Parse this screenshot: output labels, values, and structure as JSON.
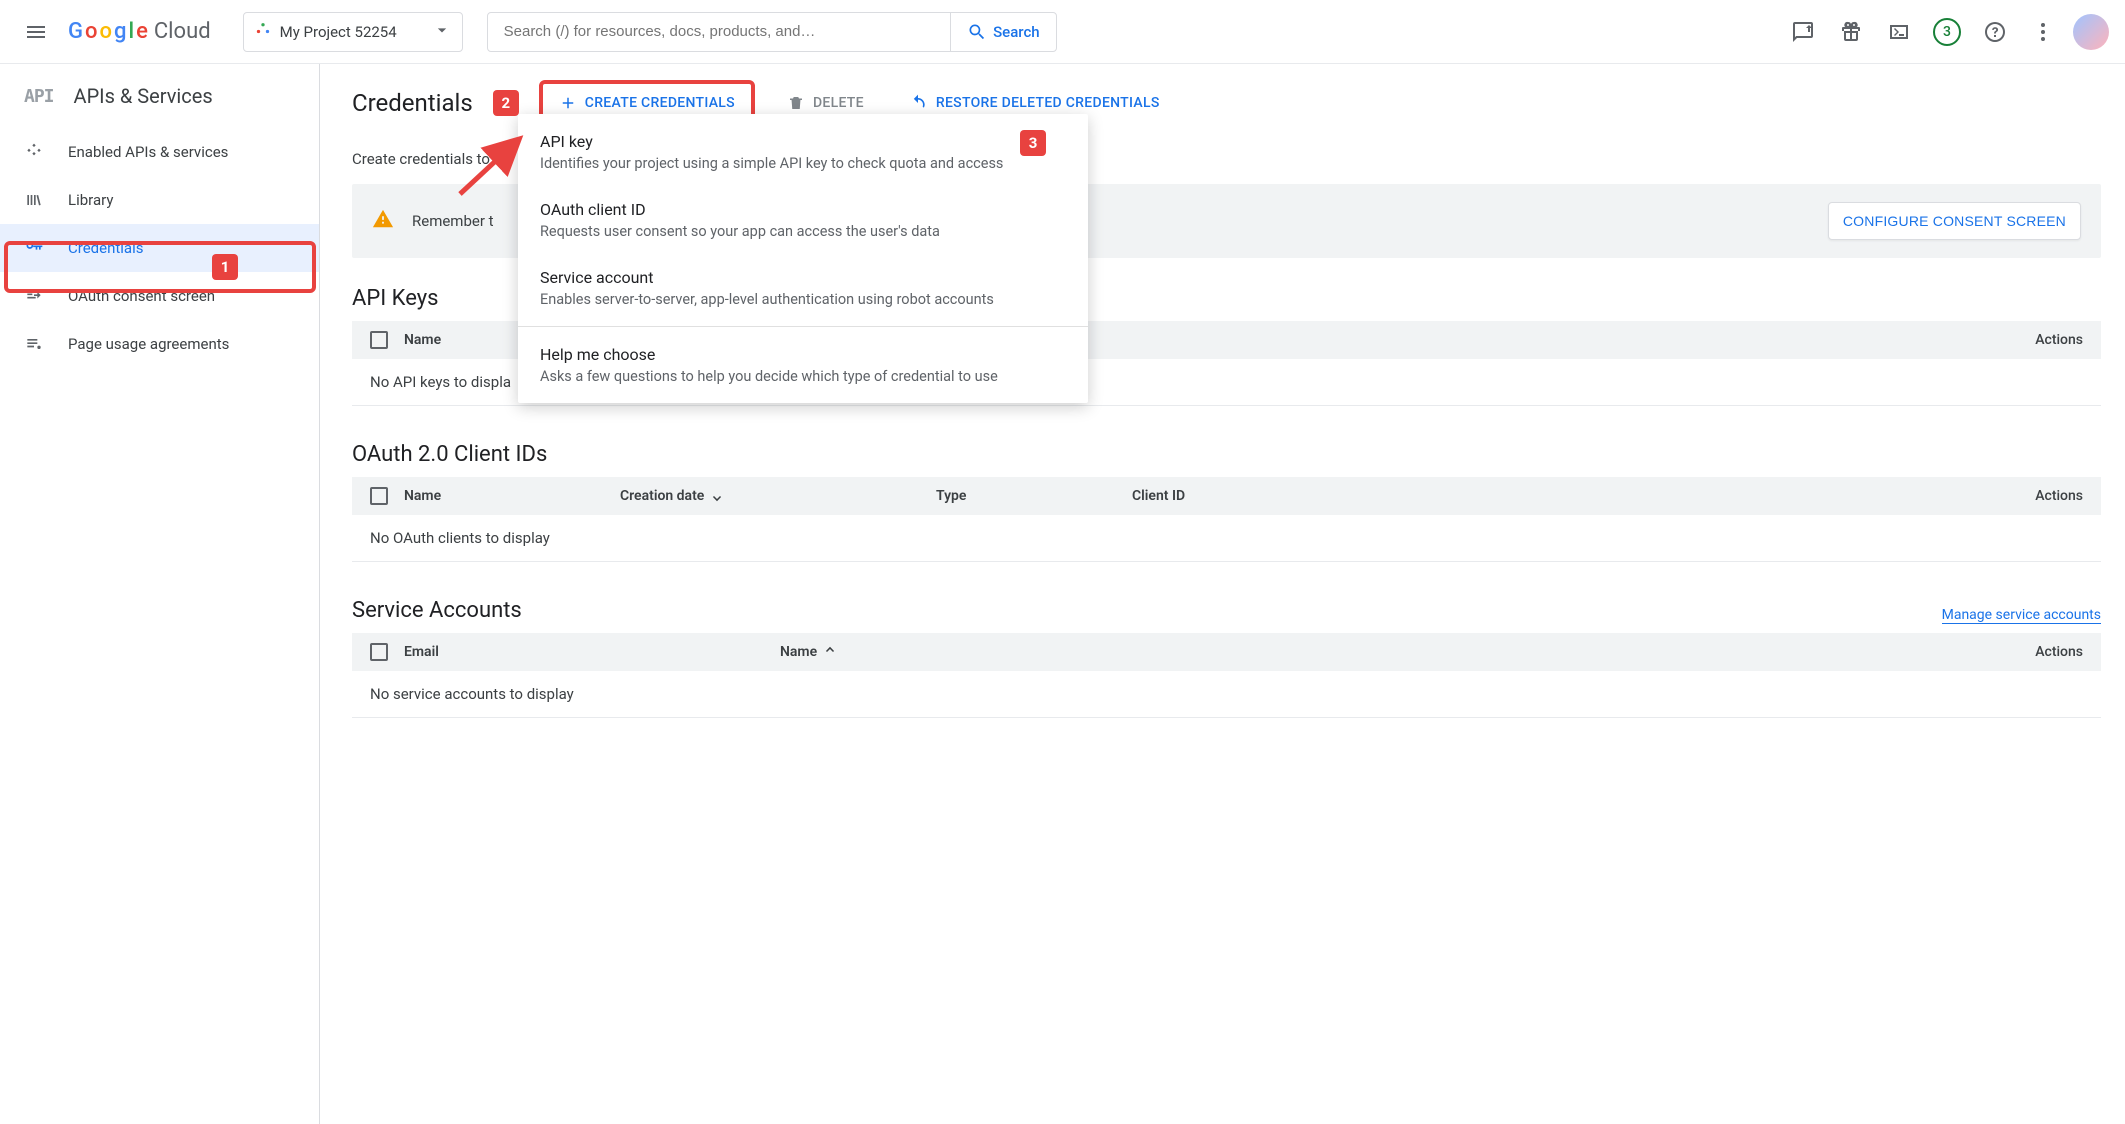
{
  "topbar": {
    "project_name": "My Project 52254",
    "search_placeholder": "Search (/) for resources, docs, products, and…",
    "search_button": "Search",
    "notification_count": "3"
  },
  "sidebar": {
    "section_title": "APIs & Services",
    "items": [
      {
        "label": "Enabled APIs & services"
      },
      {
        "label": "Library"
      },
      {
        "label": "Credentials"
      },
      {
        "label": "OAuth consent screen"
      },
      {
        "label": "Page usage agreements"
      }
    ]
  },
  "page": {
    "title": "Credentials",
    "create_button": "CREATE CREDENTIALS",
    "delete_button": "DELETE",
    "restore_button": "RESTORE DELETED CREDENTIALS",
    "subhead": "Create credentials to a",
    "warn_text": "Remember t",
    "configure_button": "CONFIGURE CONSENT SCREEN"
  },
  "dropdown": {
    "items": [
      {
        "title": "API key",
        "desc": "Identifies your project using a simple API key to check quota and access"
      },
      {
        "title": "OAuth client ID",
        "desc": "Requests user consent so your app can access the user's data"
      },
      {
        "title": "Service account",
        "desc": "Enables server-to-server, app-level authentication using robot accounts"
      },
      {
        "title": "Help me choose",
        "desc": "Asks a few questions to help you decide which type of credential to use"
      }
    ]
  },
  "sections": {
    "api_keys": {
      "title": "API Keys",
      "columns": {
        "name": "Name",
        "actions": "Actions"
      },
      "empty": "No API keys to displa"
    },
    "oauth": {
      "title": "OAuth 2.0 Client IDs",
      "columns": {
        "name": "Name",
        "date": "Creation date",
        "type": "Type",
        "client": "Client ID",
        "actions": "Actions"
      },
      "empty": "No OAuth clients to display"
    },
    "service": {
      "title": "Service Accounts",
      "manage_link": "Manage service accounts",
      "columns": {
        "email": "Email",
        "name": "Name",
        "actions": "Actions"
      },
      "empty": "No service accounts to display"
    }
  },
  "annotations": {
    "badge1": "1",
    "badge2": "2",
    "badge3": "3"
  }
}
